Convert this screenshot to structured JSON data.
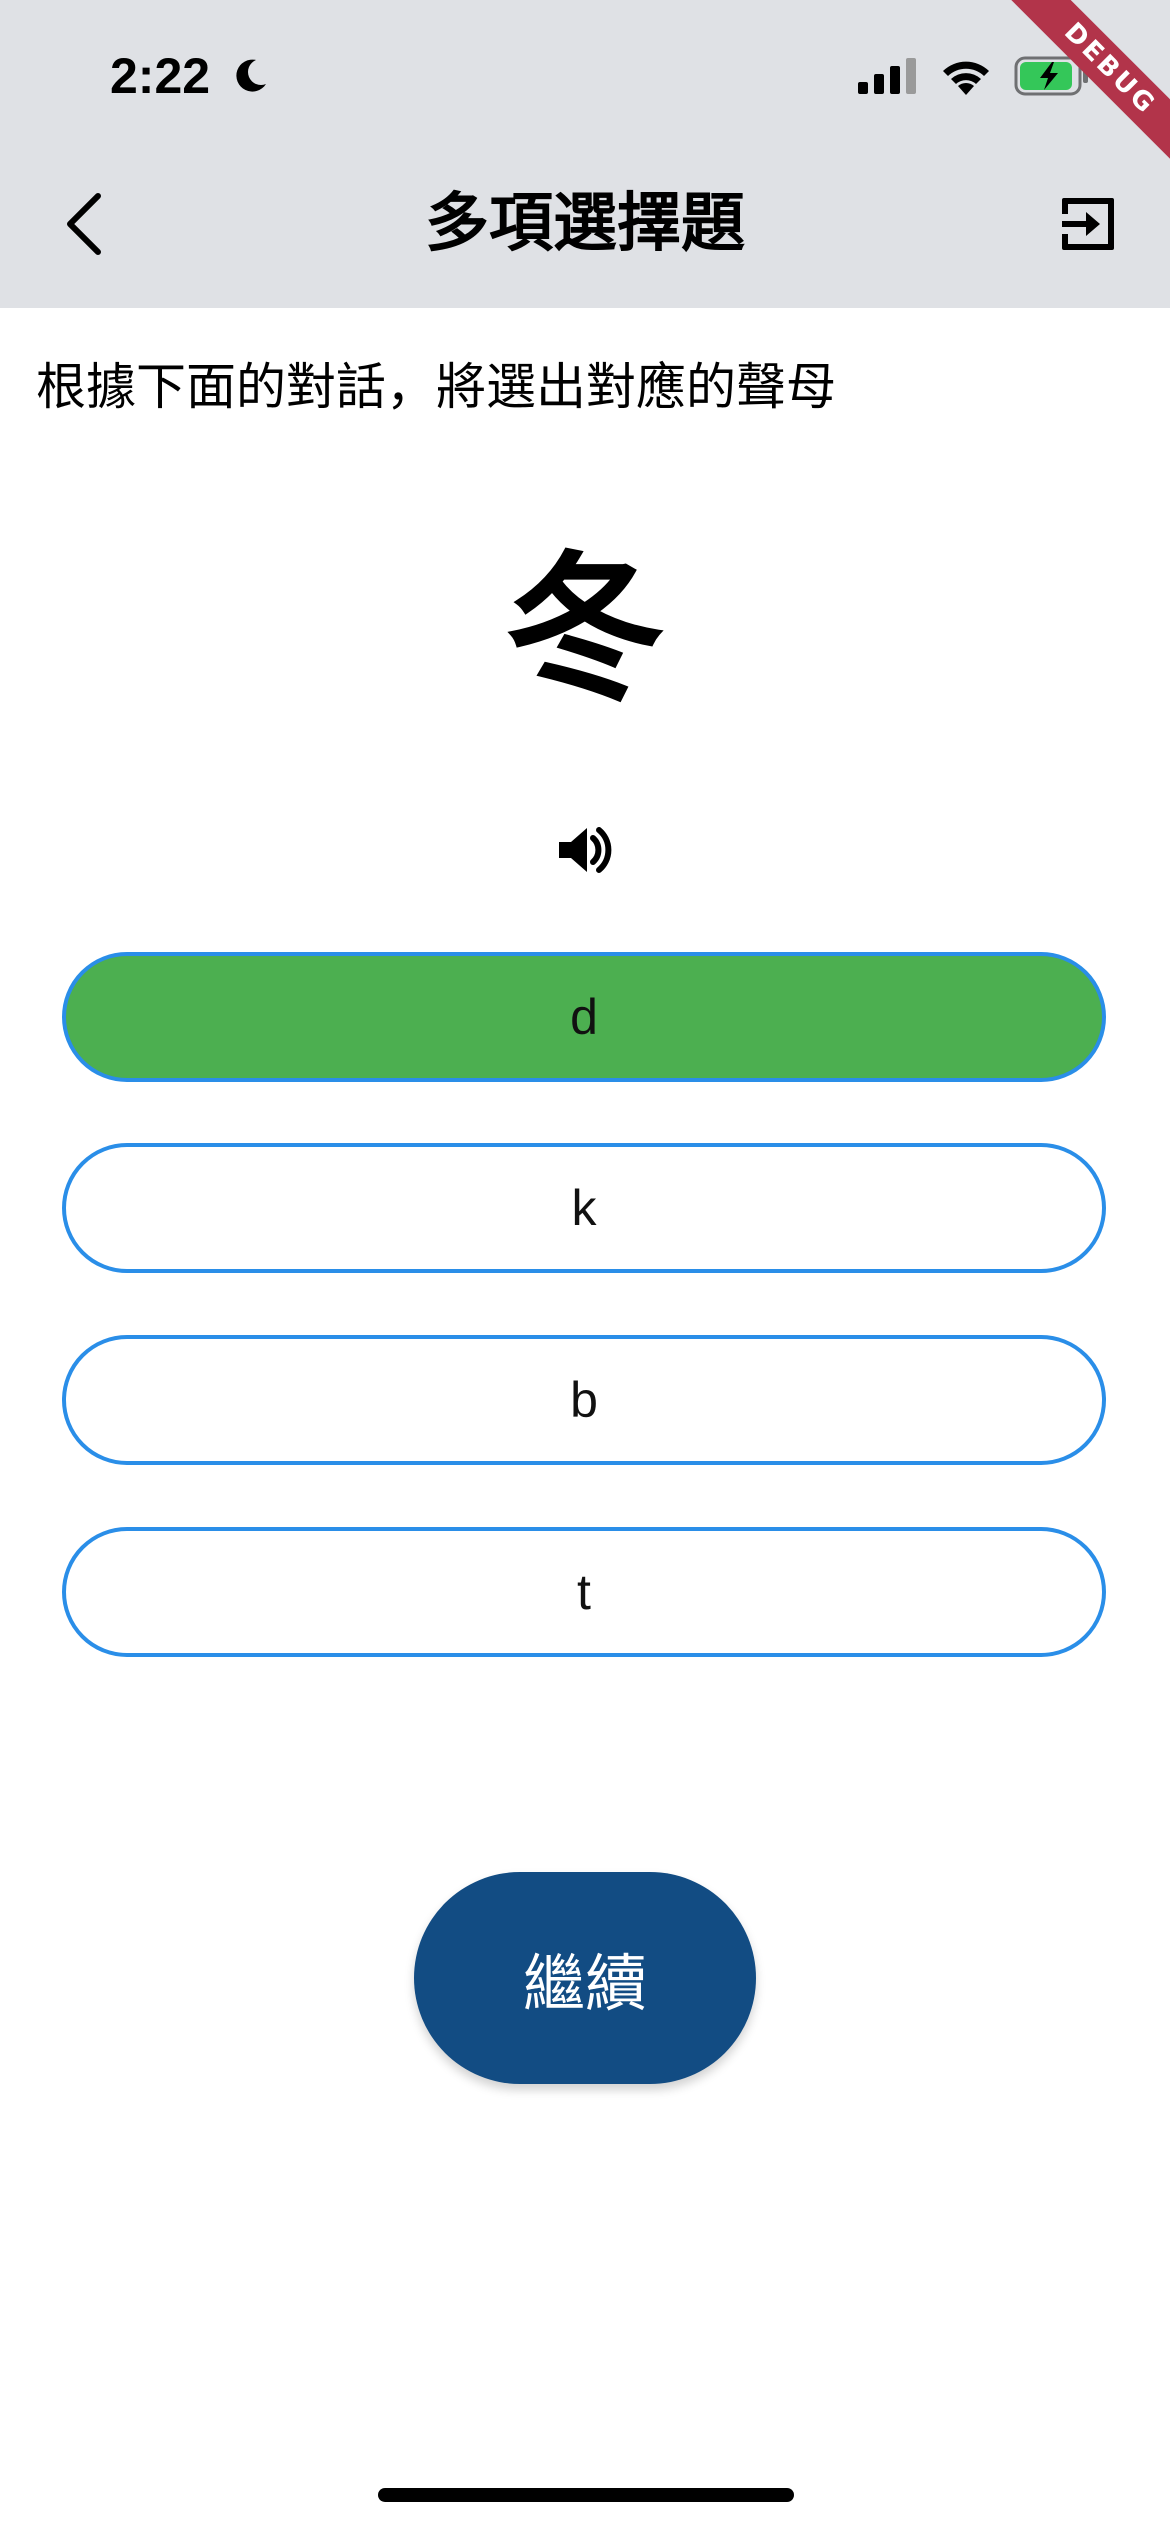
{
  "status_bar": {
    "time": "2:22",
    "moon_icon": "moon-icon",
    "signal_icon": "cellular-signal-icon",
    "wifi_icon": "wifi-icon",
    "battery_icon": "battery-charging-icon",
    "battery_color": "#34c759"
  },
  "debug_banner": {
    "label": "DEBUG",
    "color": "#b2344a"
  },
  "app_bar": {
    "title": "多項選擇題",
    "back_icon": "chevron-left-icon",
    "exit_icon": "exit-icon",
    "background": "#dfe1e5"
  },
  "question": {
    "instruction": "根據下面的對話，將選出對應的聲母",
    "character": "冬",
    "audio_icon": "speaker-icon"
  },
  "options": [
    {
      "label": "d",
      "selected": true
    },
    {
      "label": "k",
      "selected": false
    },
    {
      "label": "b",
      "selected": false
    },
    {
      "label": "t",
      "selected": false
    }
  ],
  "colors": {
    "option_border": "#2a8ee8",
    "selected_fill": "#4caf50",
    "continue_button": "#124c83"
  },
  "continue_button": {
    "label": "繼續"
  }
}
